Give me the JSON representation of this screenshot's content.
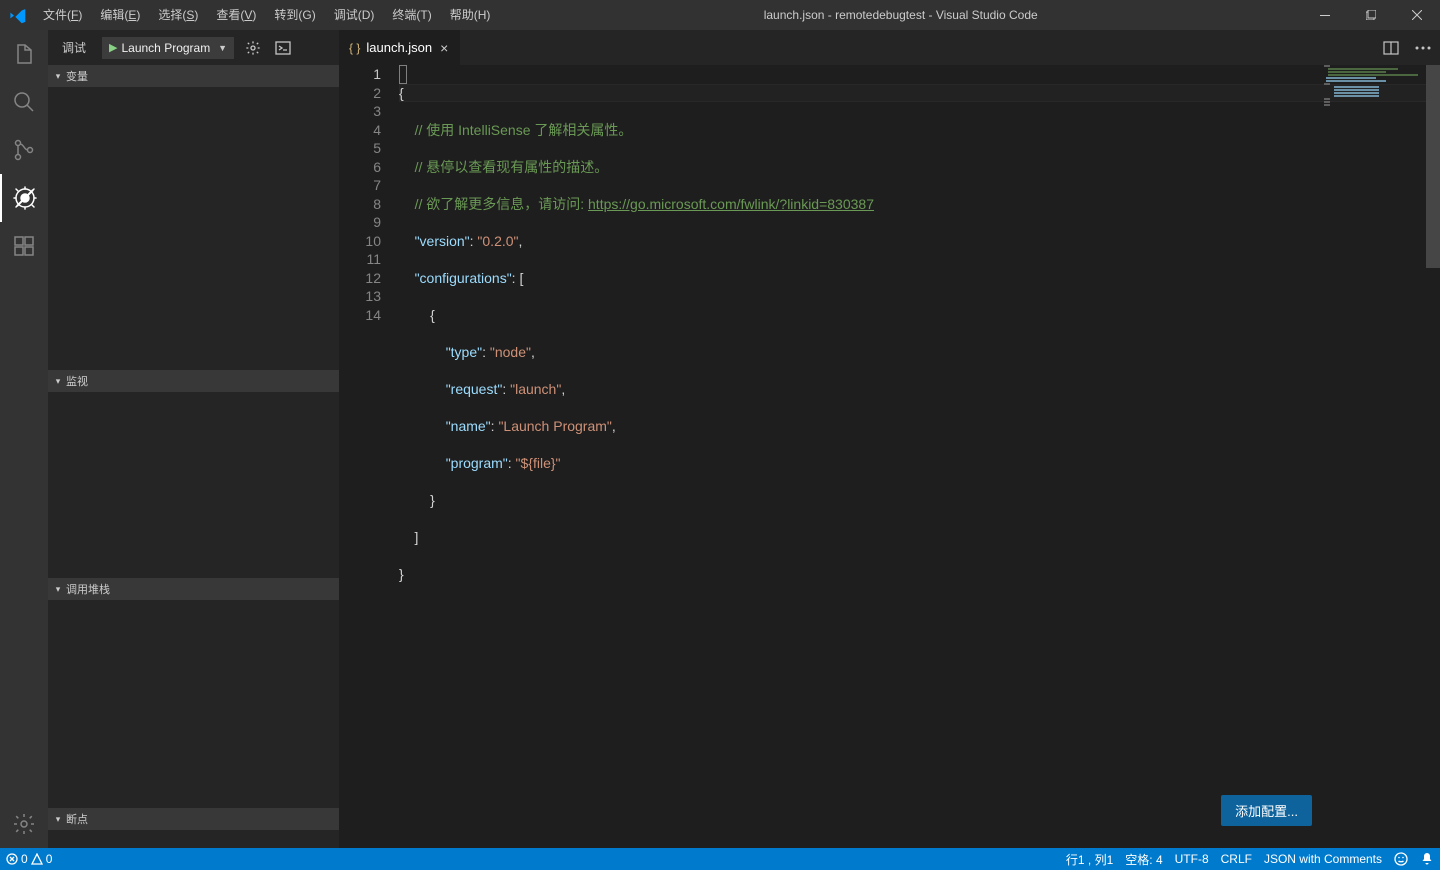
{
  "window": {
    "title": "launch.json - remotedebugtest - Visual Studio Code"
  },
  "menu": {
    "file": "文件(<u class='mnem'>F</u>)",
    "edit": "编辑(<u class='mnem'>E</u>)",
    "select": "选择(<u class='mnem'>S</u>)",
    "view": "查看(<u class='mnem'>V</u>)",
    "go_raw": "转到(G)",
    "debug_raw": "调试(D)",
    "terminal_raw": "终端(T)",
    "help_raw": "帮助(H)"
  },
  "sidebar": {
    "title": "调试",
    "config": "Launch Program",
    "panels": {
      "variables": "变量",
      "watch": "监视",
      "callstack": "调用堆栈",
      "breakpoints": "断点"
    }
  },
  "tab": {
    "filename": "launch.json"
  },
  "button": {
    "add_config": "添加配置..."
  },
  "code": {
    "l1": "{",
    "l2_comment": "// 使用 IntelliSense 了解相关属性。",
    "l3_comment": "// 悬停以查看现有属性的描述。",
    "l4_comment_prefix": "// 欲了解更多信息，请访问: ",
    "l4_link": "https://go.microsoft.com/fwlink/?linkid=830387",
    "l5_k": "\"version\"",
    "l5_v": "\"0.2.0\"",
    "l6_k": "\"configurations\"",
    "l8_k": "\"type\"",
    "l8_v": "\"node\"",
    "l9_k": "\"request\"",
    "l9_v": "\"launch\"",
    "l10_k": "\"name\"",
    "l10_v": "\"Launch Program\"",
    "l11_k": "\"program\"",
    "l11_v": "\"${file}\"",
    "l14": "}"
  },
  "status": {
    "errors": "0",
    "warnings": "0",
    "cursor": "行1 , 列1",
    "spaces": "空格: 4",
    "encoding": "UTF-8",
    "eol": "CRLF",
    "lang": "JSON with Comments"
  }
}
